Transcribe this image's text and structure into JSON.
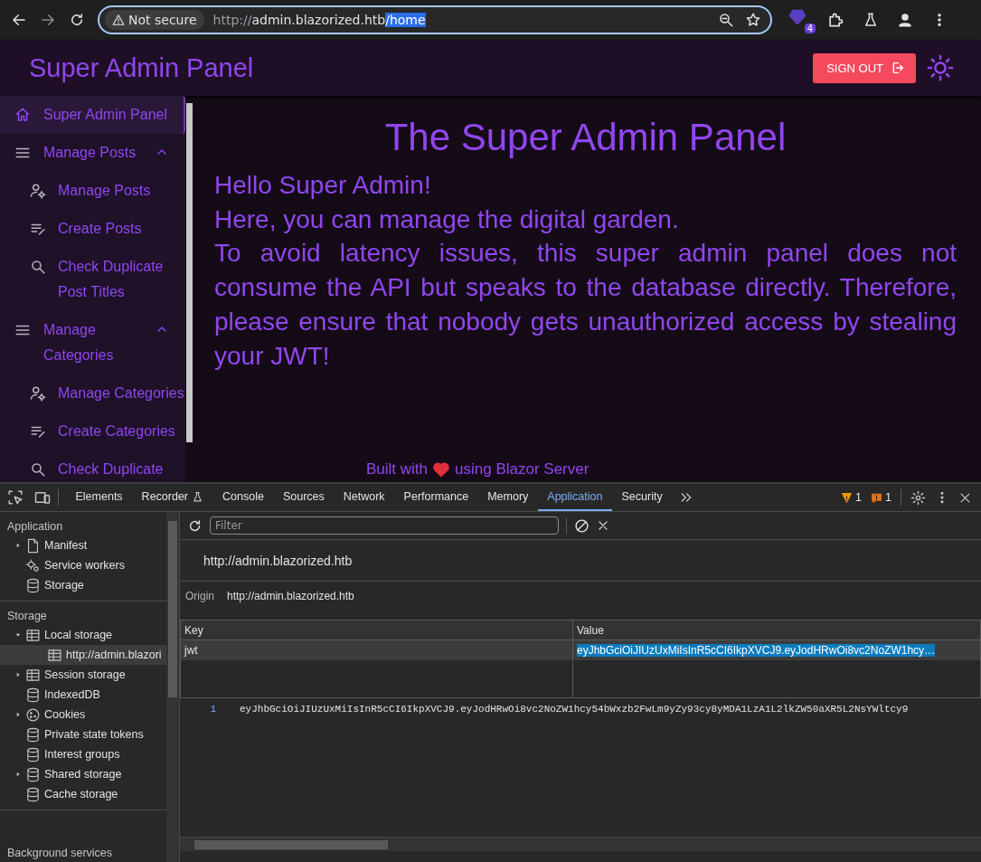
{
  "browser": {
    "security": "Not secure",
    "url_scheme": "http://",
    "url_host": "admin.blazorized.htb",
    "url_path": "/home",
    "extension_badge": "4"
  },
  "app": {
    "title": "Super Admin Panel",
    "sign_out": "SIGN OUT",
    "sidebar": [
      {
        "kind": "home",
        "label": "Super Admin Panel",
        "selected": true
      },
      {
        "kind": "group",
        "label": "Manage Posts",
        "selected": false,
        "expanded": true,
        "children": [
          {
            "kind": "manage",
            "label": "Manage Posts",
            "selected": false
          },
          {
            "kind": "create",
            "label": "Create Posts",
            "selected": false
          },
          {
            "kind": "search",
            "label": "Check Duplicate Post Titles",
            "selected": false
          }
        ]
      },
      {
        "kind": "group",
        "label": "Manage Categories",
        "selected": false,
        "expanded": true,
        "children": [
          {
            "kind": "manage",
            "label": "Manage Categories",
            "selected": false
          },
          {
            "kind": "create",
            "label": "Create Categories",
            "selected": false
          },
          {
            "kind": "search",
            "label": "Check Duplicate",
            "selected": false
          }
        ]
      }
    ],
    "heading": "The Super Admin Panel",
    "paragraphs": [
      "Hello Super Admin!",
      "Here, you can manage the digital garden.",
      "To avoid latency issues, this super admin panel does not consume the API but speaks to the database directly. Therefore, please ensure that nobody gets unauthorized access by stealing your JWT!"
    ],
    "footer": {
      "before": "Built with",
      "after": "using Blazor Server"
    }
  },
  "devtools": {
    "tabs": [
      {
        "label": "Elements",
        "selected": false
      },
      {
        "label": "Recorder",
        "selected": false
      },
      {
        "label": "Console",
        "selected": false
      },
      {
        "label": "Sources",
        "selected": false
      },
      {
        "label": "Network",
        "selected": false
      },
      {
        "label": "Performance",
        "selected": false
      },
      {
        "label": "Memory",
        "selected": false
      },
      {
        "label": "Application",
        "selected": true
      },
      {
        "label": "Security",
        "selected": false
      }
    ],
    "warnings": "1",
    "issues": "1",
    "sidebar": [
      {
        "title": "Application",
        "items": [
          {
            "kind": "file",
            "label": "Manifest",
            "selected": false,
            "expanded": false
          },
          {
            "kind": "gear",
            "label": "Service workers",
            "selected": false
          },
          {
            "kind": "database",
            "label": "Storage",
            "selected": false
          }
        ]
      },
      {
        "title": "Storage",
        "items": [
          {
            "kind": "table",
            "label": "Local storage",
            "selected": false,
            "expanded": true,
            "children": [
              {
                "kind": "table",
                "label": "http://admin.blazori",
                "selected": true
              }
            ]
          },
          {
            "kind": "table",
            "label": "Session storage",
            "selected": false,
            "expanded": false
          },
          {
            "kind": "database",
            "label": "IndexedDB",
            "selected": false
          },
          {
            "kind": "cookie",
            "label": "Cookies",
            "selected": false,
            "expanded": false
          },
          {
            "kind": "database",
            "label": "Private state tokens",
            "selected": false
          },
          {
            "kind": "database",
            "label": "Interest groups",
            "selected": false
          },
          {
            "kind": "database",
            "label": "Shared storage",
            "selected": false,
            "expanded": false
          },
          {
            "kind": "database",
            "label": "Cache storage",
            "selected": false
          }
        ]
      },
      {
        "title": "Background services"
      }
    ],
    "filter": {
      "placeholder": "Filter"
    },
    "origin_title": "http://admin.blazorized.htb",
    "origin_label": "Origin",
    "origin_value": "http://admin.blazorized.htb",
    "table": {
      "columns": [
        "Key",
        "Value"
      ],
      "rows": [
        {
          "key": "jwt",
          "value": "eyJhbGciOiJIUzUxMiIsInR5cCI6IkpXVCJ9.eyJodHRwOi8vc2NoZW1hcy…",
          "selected": true
        }
      ]
    },
    "preview": {
      "line_number": "1",
      "text": "eyJhbGciOiJIUzUxMiIsInR5cCI6IkpXVCJ9.eyJodHRwOi8vc2NoZW1hcy54bWxzb2FwLm9yZy93cy8yMDA1LzA1L2lkZW50aXR5L2NsYWltcy9"
    }
  }
}
